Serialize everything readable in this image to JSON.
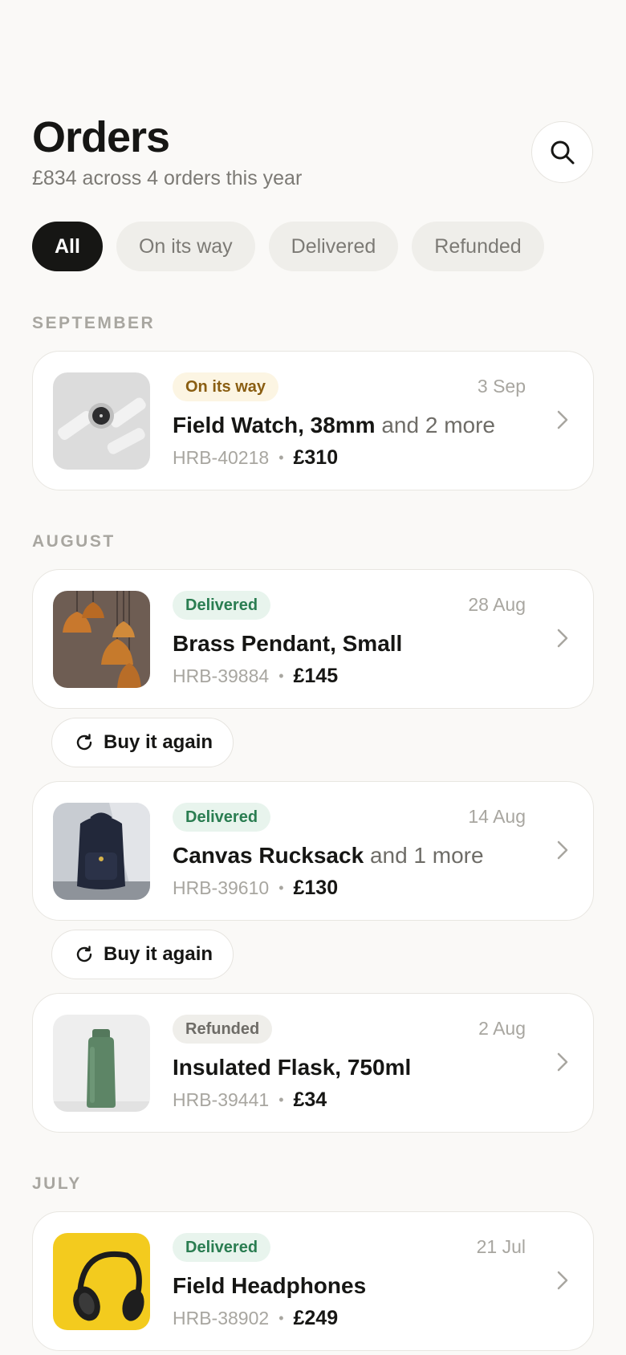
{
  "header": {
    "title": "Orders",
    "subtitle": "£834 across 4 orders this year"
  },
  "filters": [
    "All",
    "On its way",
    "Delivered",
    "Refunded"
  ],
  "active_filter": "All",
  "sections": {
    "september": "SEPTEMBER",
    "august": "AUGUST",
    "july": "JULY"
  },
  "buy_again_label": "Buy it again",
  "orders": [
    {
      "status": "On its way",
      "date": "3 Sep",
      "item": "Field Watch, 38mm",
      "more": "and 2 more",
      "id": "HRB-40218",
      "separator": "•",
      "price": "£310"
    },
    {
      "status": "Delivered",
      "date": "28 Aug",
      "item": "Brass Pendant, Small",
      "more": "",
      "id": "HRB-39884",
      "separator": "•",
      "price": "£145"
    },
    {
      "status": "Delivered",
      "date": "14 Aug",
      "item": "Canvas Rucksack",
      "more": "and 1 more",
      "id": "HRB-39610",
      "separator": "•",
      "price": "£130"
    },
    {
      "status": "Refunded",
      "date": "2 Aug",
      "item": "Insulated Flask, 750ml",
      "more": "",
      "id": "HRB-39441",
      "separator": "•",
      "price": "£34"
    },
    {
      "status": "Delivered",
      "date": "21 Jul",
      "item": "Field Headphones",
      "more": "",
      "id": "HRB-38902",
      "separator": "•",
      "price": "£249"
    }
  ],
  "colors": {
    "background": "#faf9f7",
    "transit_badge": "#8a5e12",
    "delivered_badge": "#2a7d51",
    "refunded_badge": "#6e6c67"
  },
  "icons": [
    "search-icon",
    "chevron-right-icon",
    "refresh-icon"
  ]
}
